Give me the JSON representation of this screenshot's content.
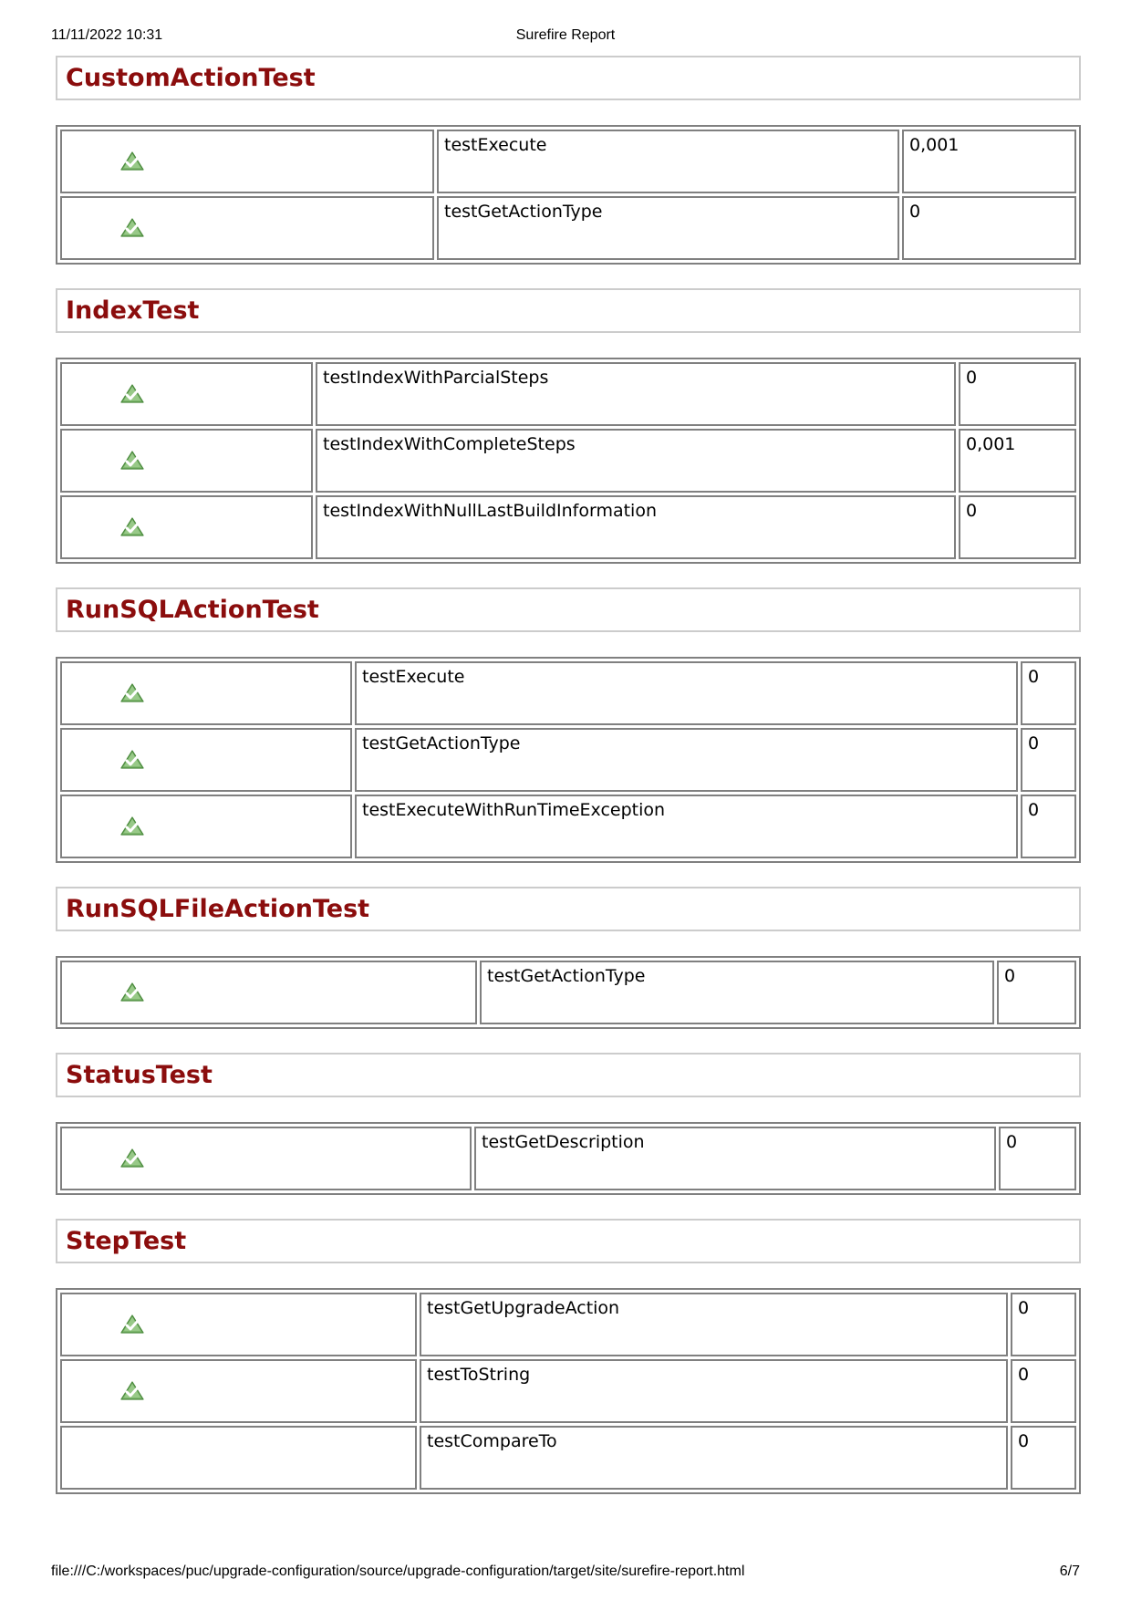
{
  "print_header": {
    "date": "11/11/2022 10:31",
    "title": "Surefire Report"
  },
  "sections": [
    {
      "title": "CustomActionTest",
      "tests": [
        {
          "name": "testExecute",
          "time": "0,001"
        },
        {
          "name": "testGetActionType",
          "time": "0"
        }
      ]
    },
    {
      "title": "IndexTest",
      "tests": [
        {
          "name": "testIndexWithParcialSteps",
          "time": "0"
        },
        {
          "name": "testIndexWithCompleteSteps",
          "time": "0,001"
        },
        {
          "name": "testIndexWithNullLastBuildInformation",
          "time": "0"
        }
      ]
    },
    {
      "title": "RunSQLActionTest",
      "tests": [
        {
          "name": "testExecute",
          "time": "0"
        },
        {
          "name": "testGetActionType",
          "time": "0"
        },
        {
          "name": "testExecuteWithRunTimeException",
          "time": "0"
        }
      ]
    },
    {
      "title": "RunSQLFileActionTest",
      "tests": [
        {
          "name": "testGetActionType",
          "time": "0"
        }
      ]
    },
    {
      "title": "StatusTest",
      "tests": [
        {
          "name": "testGetDescription",
          "time": "0"
        }
      ]
    },
    {
      "title": "StepTest",
      "tests": [
        {
          "name": "testGetUpgradeAction",
          "time": "0"
        },
        {
          "name": "testToString",
          "time": "0"
        },
        {
          "name": "testCompareTo",
          "time": "0"
        }
      ]
    }
  ],
  "print_footer": {
    "url": "file:///C:/workspaces/puc/upgrade-configuration/source/upgrade-configuration/target/site/surefire-report.html",
    "page": "6/7"
  },
  "icons": {
    "status": "success-icon"
  }
}
